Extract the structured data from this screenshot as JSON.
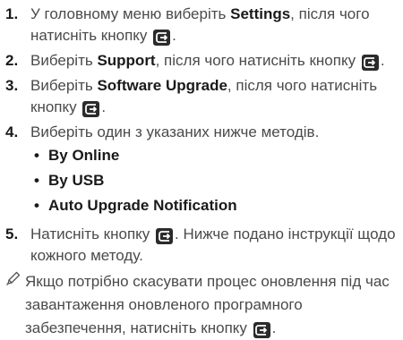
{
  "icons": {
    "enter_button": "enter-button-icon",
    "note": "pencil-note-icon",
    "bullet": "•"
  },
  "colors": {
    "text": "#4a4a4a",
    "emphasis": "#1a1a1a",
    "button_fill": "#2b2b2b"
  },
  "steps": [
    {
      "number": "1.",
      "before": "У головному меню виберіть ",
      "keyword": "Settings",
      "after": ", після чого натисніть кнопку "
    },
    {
      "number": "2.",
      "before": "Виберіть ",
      "keyword": "Support",
      "after": ", після чого натисніть кнопку "
    },
    {
      "number": "3.",
      "before": "Виберіть ",
      "keyword": "Software Upgrade",
      "after": ", після чого натисніть кнопку "
    },
    {
      "number": "4.",
      "text": "Виберіть один з указаних нижче методів.",
      "methods": [
        "By Online",
        "By USB",
        "Auto Upgrade Notification"
      ]
    },
    {
      "number": "5.",
      "before": "Натисніть кнопку ",
      "after": ". Нижче подано інструкції щодо кожного методу."
    }
  ],
  "period": ".",
  "note": {
    "before": "Якщо потрібно скасувати процес оновлення під час завантаження оновленого програмного забезпечення, натисніть кнопку ",
    "after": "."
  }
}
